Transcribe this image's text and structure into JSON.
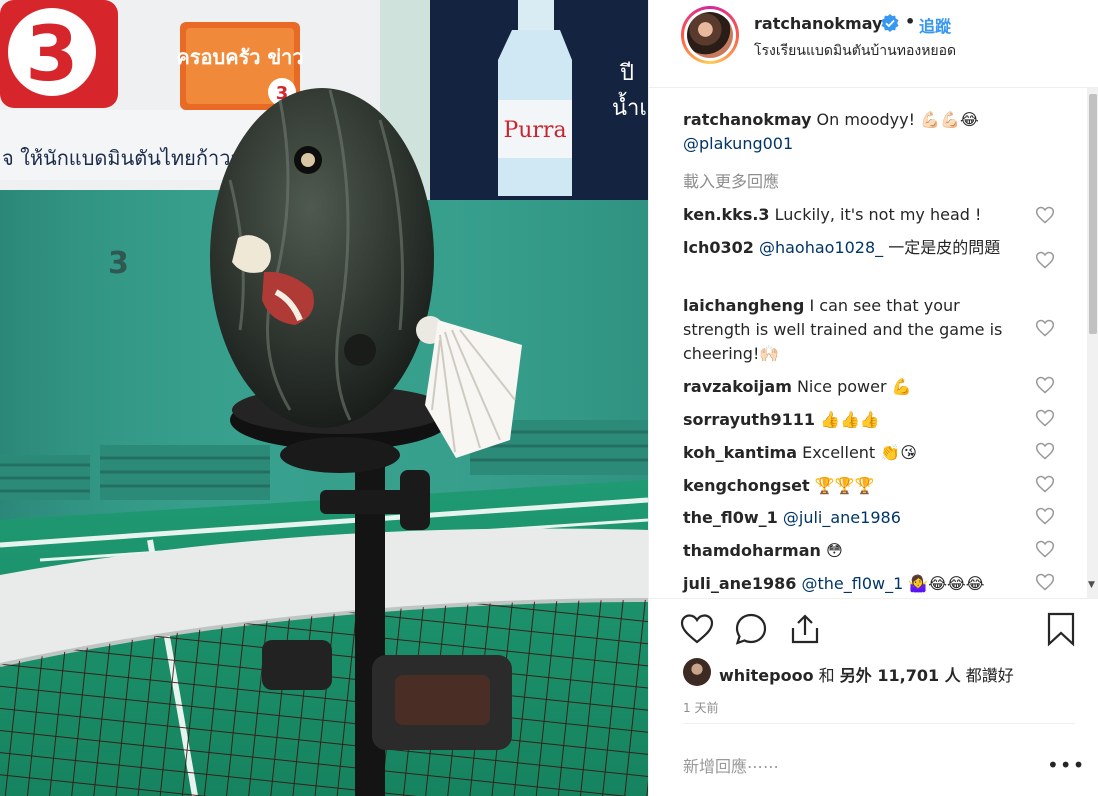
{
  "photo": {
    "sign_channel": "3",
    "sign_thai_banner": "ครอบครัว ข่าว",
    "sign_number": "3",
    "wall_text": "จ ให้นักแบดมินตันไทยก้าวสู่",
    "bottle_brand": "Purra",
    "court_number": "3",
    "thai_right": "ปี\nน้ำเ"
  },
  "header": {
    "username": "ratchanokmay",
    "dot": "•",
    "follow_label": "追蹤",
    "location": "โรงเรียนแบดมินตันบ้านทองหยอด"
  },
  "caption": {
    "username": "ratchanokmay",
    "text": " On moodyy! 💪🏻💪🏻😂",
    "mention": "@plakung001"
  },
  "load_more": "載入更多回應",
  "comments": [
    {
      "user": "ken.kks.3",
      "text": " Luckily, it's not my head !"
    },
    {
      "user": "lch0302",
      "mention": " @haohao1028_",
      "text": " 一定是皮的問題"
    },
    {
      "user": "laichangheng",
      "text": " I can see that your strength is well trained and the game is cheering!🙌🏻"
    },
    {
      "user": "ravzakoijam",
      "text": " Nice power 💪"
    },
    {
      "user": "sorrayuth9111",
      "text": " 👍👍👍"
    },
    {
      "user": "koh_kantima",
      "text": " Excellent 👏😘"
    },
    {
      "user": "kengchongset",
      "text": " 🏆🏆🏆"
    },
    {
      "user": "the_fl0w_1",
      "mention": " @juli_ane1986",
      "text": ""
    },
    {
      "user": "thamdoharman",
      "text": " 😳"
    },
    {
      "user": "juli_ane1986",
      "mention": " @the_fl0w_1",
      "text": " 🤷‍♀️😂😂😂"
    }
  ],
  "likes": {
    "user": "whitepooo",
    "middle": " 和 ",
    "count": "另外 11,701 人",
    "suffix": " 都讚好"
  },
  "time": "1 天前",
  "add_comment_placeholder": "新增回應⋯⋯",
  "more_label": "•••",
  "colors": {
    "link": "#3897f0",
    "mention": "#003569",
    "text": "#262626",
    "muted": "#8e8e8e",
    "border": "#efefef"
  }
}
